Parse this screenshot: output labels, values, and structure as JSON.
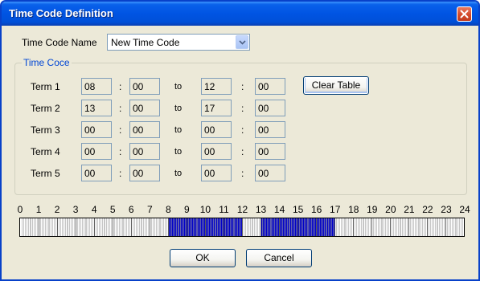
{
  "window": {
    "title": "Time Code Definition",
    "close_icon": "close-icon"
  },
  "name_row": {
    "label": "Time Code Name",
    "selected": "New Time Code"
  },
  "group": {
    "legend": "Time Coce"
  },
  "terms": [
    {
      "label": "Term 1",
      "start_h": "08",
      "start_m": "00",
      "to": "to",
      "end_h": "12",
      "end_m": "00"
    },
    {
      "label": "Term 2",
      "start_h": "13",
      "start_m": "00",
      "to": "to",
      "end_h": "17",
      "end_m": "00"
    },
    {
      "label": "Term 3",
      "start_h": "00",
      "start_m": "00",
      "to": "to",
      "end_h": "00",
      "end_m": "00"
    },
    {
      "label": "Term 4",
      "start_h": "00",
      "start_m": "00",
      "to": "to",
      "end_h": "00",
      "end_m": "00"
    },
    {
      "label": "Term 5",
      "start_h": "00",
      "start_m": "00",
      "to": "to",
      "end_h": "00",
      "end_m": "00"
    }
  ],
  "separator": ":",
  "buttons": {
    "clear_table": "Clear Table",
    "ok": "OK",
    "cancel": "Cancel"
  },
  "timeline": {
    "hours": [
      "0",
      "1",
      "2",
      "3",
      "4",
      "5",
      "6",
      "7",
      "8",
      "9",
      "10",
      "11",
      "12",
      "13",
      "14",
      "15",
      "16",
      "17",
      "18",
      "19",
      "20",
      "21",
      "22",
      "23",
      "24"
    ],
    "fill_color": "#0000c8",
    "tick_color": "#a0a0a0"
  }
}
